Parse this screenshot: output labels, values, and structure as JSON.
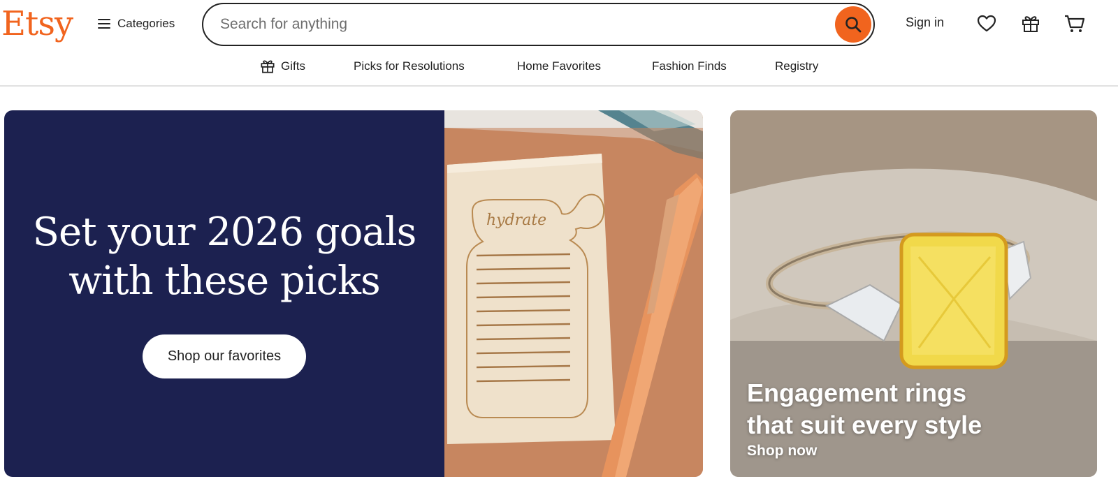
{
  "header": {
    "logo": "Etsy",
    "categories_label": "Categories",
    "search": {
      "placeholder": "Search for anything",
      "value": ""
    },
    "sign_in": "Sign in",
    "icons": [
      "search-icon",
      "heart-icon",
      "gift-icon",
      "cart-icon",
      "menu-icon"
    ]
  },
  "subnav": {
    "items": [
      {
        "label": "Gifts",
        "icon": "gift-icon"
      },
      {
        "label": "Picks for Resolutions"
      },
      {
        "label": "Home Favorites"
      },
      {
        "label": "Fashion Finds"
      },
      {
        "label": "Registry"
      }
    ]
  },
  "hero": {
    "headline_line1": "Set your 2026 goals",
    "headline_line2": "with these picks",
    "cta": "Shop our favorites",
    "image_text": "hydrate"
  },
  "promo": {
    "title_line1": "Engagement rings",
    "title_line2": "that suit every style",
    "link": "Shop now"
  },
  "colors": {
    "brand": "#f1641e",
    "hero_bg": "#1c2150",
    "text": "#222222"
  }
}
